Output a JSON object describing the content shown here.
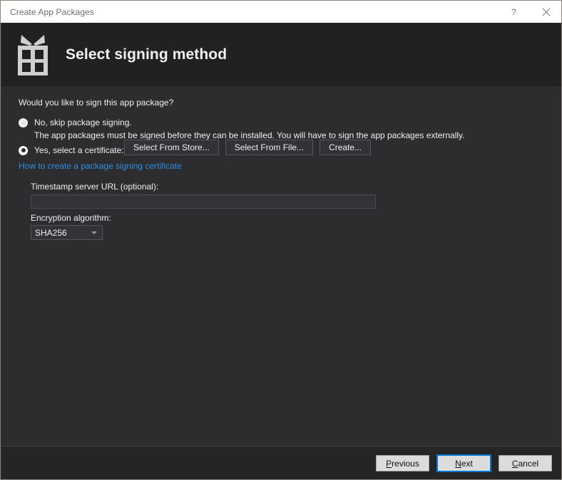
{
  "titlebar": {
    "title": "Create App Packages",
    "help_icon": "question-mark-icon",
    "close_icon": "close-icon"
  },
  "header": {
    "icon": "gift-box-icon",
    "title": "Select signing method"
  },
  "main": {
    "question": "Would you like to sign this app package?",
    "options": [
      {
        "id": "skip",
        "label": "No, skip package signing.",
        "selected": false,
        "description": "The app packages must be signed before they can be installed. You will have to sign the app packages externally."
      },
      {
        "id": "certificate",
        "label": "Yes, select a certificate:",
        "selected": true
      }
    ],
    "cert_buttons": [
      {
        "label": "Select From Store..."
      },
      {
        "label": "Select From File..."
      },
      {
        "label": "Create..."
      }
    ],
    "help_link": "How to create a package signing certificate",
    "timestamp": {
      "label": "Timestamp server URL (optional):",
      "value": "",
      "placeholder": ""
    },
    "encryption": {
      "label": "Encryption algorithm:",
      "value": "SHA256",
      "arrow_icon": "chevron-down-icon"
    }
  },
  "footer": {
    "previous": {
      "prefix": "",
      "accesskey": "P",
      "suffix": "revious"
    },
    "next": {
      "prefix": "",
      "accesskey": "N",
      "suffix": "ext"
    },
    "cancel": {
      "prefix": "",
      "accesskey": "C",
      "suffix": "ancel"
    }
  },
  "colors": {
    "titlebar_bg": "#ffffff",
    "header_bg": "#212121",
    "body_bg": "#2d2d30",
    "footer_bg": "#252526",
    "link": "#2f8ee0",
    "focus": "#0078d7",
    "text": "#f0f0f0"
  }
}
